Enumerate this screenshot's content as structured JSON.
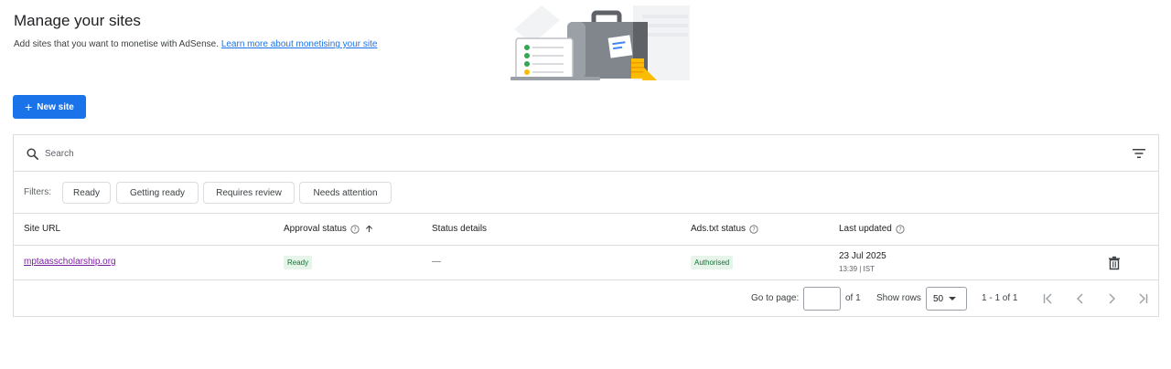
{
  "header": {
    "title": "Manage your sites",
    "subtitle": "Add sites that you want to monetise with AdSense.",
    "learn_more": "Learn more about monetising your site"
  },
  "new_site_button": {
    "icon": "+",
    "label": "New site"
  },
  "search": {
    "placeholder": "Search"
  },
  "filters": {
    "label": "Filters:",
    "chips": [
      "Ready",
      "Getting ready",
      "Requires review",
      "Needs attention"
    ]
  },
  "table": {
    "columns": [
      "Site URL",
      "Approval status",
      "Status details",
      "Ads.txt status",
      "Last updated"
    ],
    "rows": [
      {
        "site_url": "mptaasscholarship.org",
        "approval_status": "Ready",
        "status_details": "—",
        "ads_txt_status": "Authorised",
        "last_updated_date": "23 Jul 2025",
        "last_updated_time": "13:39 | IST"
      }
    ]
  },
  "pagination": {
    "go_to_page": "Go to page:",
    "of_pages": "of 1",
    "show_rows": "Show rows",
    "rows_value": "50",
    "range": "1 - 1 of 1"
  },
  "colors": {
    "primary": "#1a73e8",
    "visited_link": "#7b1fa2",
    "badge_bg": "#e6f4ea",
    "badge_text": "#137333",
    "border": "#dadce0"
  }
}
